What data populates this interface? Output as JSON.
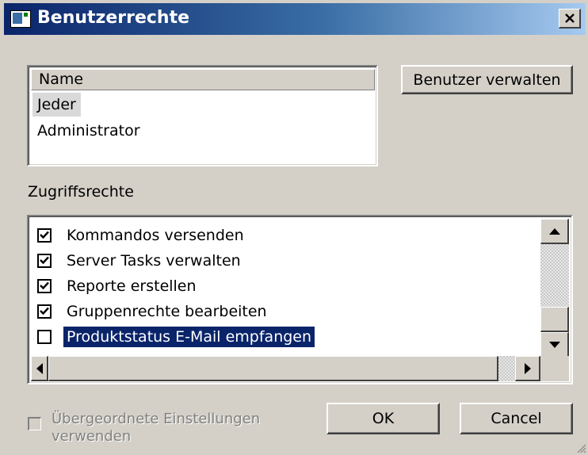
{
  "window": {
    "title": "Benutzerrechte",
    "close_symbol": "close-icon"
  },
  "users": {
    "column_header": "Name",
    "rows": [
      {
        "name": "Jeder",
        "selected": true
      },
      {
        "name": "Administrator",
        "selected": false
      }
    ],
    "manage_button": "Benutzer verwalten"
  },
  "rights": {
    "label": "Zugriffsrechte",
    "items": [
      {
        "label": "Kommandos versenden",
        "checked": true,
        "selected": false
      },
      {
        "label": "Server Tasks verwalten",
        "checked": true,
        "selected": false
      },
      {
        "label": "Reporte erstellen",
        "checked": true,
        "selected": false
      },
      {
        "label": "Gruppenrechte bearbeiten",
        "checked": true,
        "selected": false
      },
      {
        "label": "Produktstatus E-Mail empfangen",
        "checked": false,
        "selected": true
      }
    ]
  },
  "footer": {
    "inherit_label": "Übergeordnete Einstellungen verwenden",
    "inherit_checked": false,
    "inherit_enabled": false,
    "ok_button": "OK",
    "cancel_button": "Cancel"
  },
  "colors": {
    "dialog_bg": "#d4d0c8",
    "title_start": "#0a246a",
    "title_end": "#a6caf0",
    "selection": "#0a246a"
  }
}
